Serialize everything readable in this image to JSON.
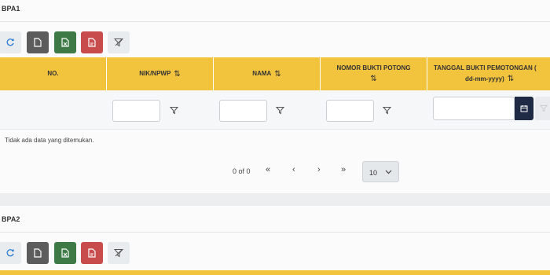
{
  "section1": {
    "title": "BPA1",
    "columns": [
      {
        "label": "NO.",
        "sortable": false
      },
      {
        "label": "NIK/NPWP",
        "sortable": true
      },
      {
        "label": "NAMA",
        "sortable": true
      },
      {
        "label": "NOMOR BUKTI POTONG",
        "sortable": true
      },
      {
        "label": "TANGGAL BUKTI PEMOTONGAN (",
        "sublabel": "dd-mm-yyyy)",
        "sortable": true
      }
    ],
    "sort_glyph": "⇅",
    "empty_message": "Tidak ada data yang ditemukan.",
    "pagination": {
      "info": "0 of 0",
      "first": "«",
      "prev": "‹",
      "next": "›",
      "last": "»",
      "rows_per_page": "10"
    }
  },
  "section2": {
    "title": "BPA2"
  },
  "colors": {
    "header": "#f2c43d",
    "pdf_button": "#c94c4c",
    "excel_button": "#3d7a45",
    "doc_button": "#5c5c5c",
    "calendar_button": "#1f2a44",
    "reload": "#2a7bd3"
  },
  "icons": [
    "reload-icon",
    "document-icon",
    "excel-icon",
    "pdf-icon",
    "filter-clear-icon",
    "filter-icon",
    "calendar-icon",
    "chevron-down-icon"
  ]
}
